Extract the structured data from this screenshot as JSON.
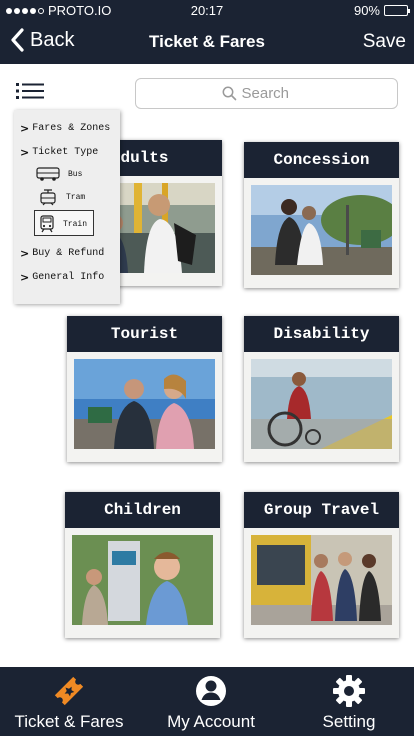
{
  "status_bar": {
    "carrier": "PROTO.IO",
    "time": "20:17",
    "battery": "90%",
    "battery_level": 0.9
  },
  "nav": {
    "back_label": "Back",
    "title": "Ticket & Fares",
    "save_label": "Save"
  },
  "search": {
    "placeholder": "Search"
  },
  "side_menu": {
    "items": [
      {
        "label": "Fares & Zones"
      },
      {
        "label": "Ticket Type",
        "sub_items": [
          "Bus",
          "Tram",
          "Train"
        ]
      },
      {
        "label": "Buy & Refund"
      },
      {
        "label": "General Info"
      }
    ]
  },
  "cards": [
    {
      "title": "Adults",
      "visible_title": "dults"
    },
    {
      "title": "Concession"
    },
    {
      "title": "Tourist"
    },
    {
      "title": "Disability"
    },
    {
      "title": "Children"
    },
    {
      "title": "Group Travel"
    }
  ],
  "tabs": [
    {
      "label": "Ticket & Fares",
      "icon": "ticket-icon"
    },
    {
      "label": "My Account",
      "icon": "account-icon"
    },
    {
      "label": "Setting",
      "icon": "gear-icon"
    }
  ],
  "colors": {
    "primary": "#1b2333",
    "accent": "#f08a24",
    "card_bg": "#f3f3f1"
  }
}
